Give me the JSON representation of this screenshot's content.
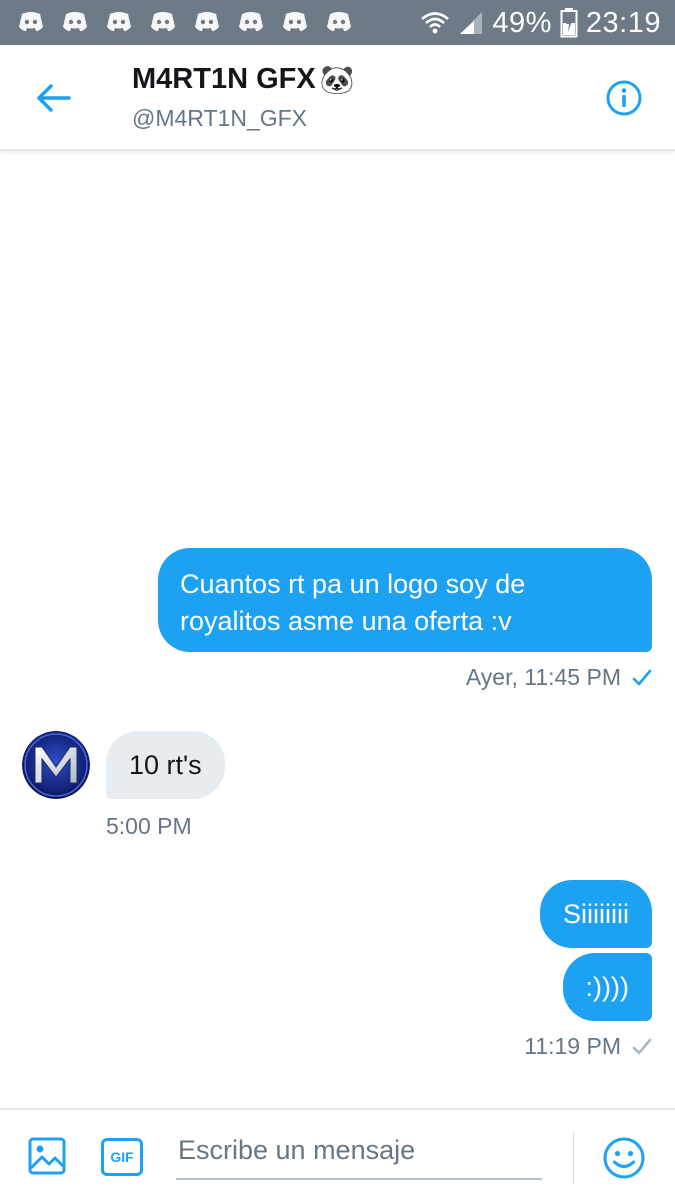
{
  "status_bar": {
    "notification_icons": [
      "discord-icon",
      "discord-icon",
      "discord-icon",
      "discord-icon",
      "discord-icon",
      "discord-icon",
      "discord-icon",
      "discord-icon"
    ],
    "battery_percent": "49%",
    "time": "23:19"
  },
  "header": {
    "name": "M4RT1N GFX",
    "name_emoji": "🐼",
    "handle": "@M4RT1N_GFX",
    "back_icon": "arrow-left-icon",
    "info_icon": "info-icon"
  },
  "messages": [
    {
      "direction": "outgoing",
      "text": "Cuantos rt pa un logo soy de royalitos asme una oferta :v"
    },
    {
      "direction": "incoming",
      "text": "10 rt's"
    },
    {
      "direction": "outgoing",
      "text": "Siiiiiiii"
    },
    {
      "direction": "outgoing",
      "text": ":))))"
    }
  ],
  "meta": {
    "msg1_time": "Ayer, 11:45 PM",
    "msg2_time": "5:00 PM",
    "msg4_time": "11:19 PM"
  },
  "composer": {
    "placeholder": "Escribe un mensaje",
    "gif_label": "GIF",
    "media_icon": "image-icon",
    "emoji_icon": "smiley-icon"
  },
  "colors": {
    "accent": "#1da1f2",
    "status_bar": "#6e7b86",
    "incoming_bubble": "#e6ecf0",
    "secondary_text": "#657786"
  }
}
